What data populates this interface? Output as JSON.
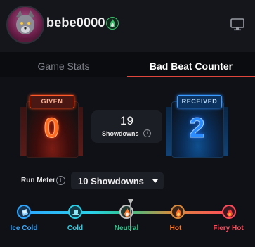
{
  "profile": {
    "username": "bebe0000",
    "badge_icon": "flame-icon",
    "avatar_icon": "wolf-avatar"
  },
  "header": {
    "screen_icon": "monitor-icon"
  },
  "tabs": [
    {
      "label": "Game Stats",
      "active": false
    },
    {
      "label": "Bad Beat Counter",
      "active": true
    }
  ],
  "counter": {
    "given": {
      "label": "GIVEN",
      "value": "0",
      "color": "#ff6a21"
    },
    "received": {
      "label": "RECEIVED",
      "value": "2",
      "color": "#2b8cff"
    },
    "showdowns": {
      "value": "19",
      "label": "Showdowns"
    }
  },
  "run_meter": {
    "label": "Run Meter",
    "selected": "10 Showdowns",
    "levels": [
      {
        "label": "Ice Cold",
        "icon": "ice-icon",
        "color": "#37a9ff"
      },
      {
        "label": "Cold",
        "icon": "hat-icon",
        "color": "#2fd0e5"
      },
      {
        "label": "Neutral",
        "icon": "flame-icon",
        "color": "#30c48b"
      },
      {
        "label": "Hot",
        "icon": "flame-icon",
        "color": "#ff7a2a"
      },
      {
        "label": "Fiery Hot",
        "icon": "fire-icon",
        "color": "#ff4b5a"
      }
    ],
    "current_level": "Neutral"
  }
}
